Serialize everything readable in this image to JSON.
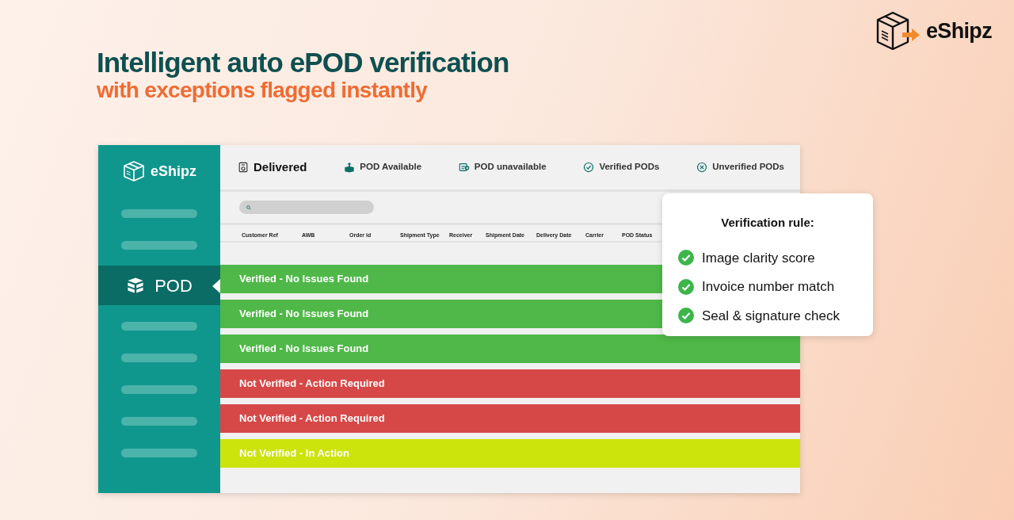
{
  "brand": {
    "name": "eShipz"
  },
  "headline": {
    "title": "Intelligent auto ePOD verification",
    "subtitle": "with exceptions flagged instantly"
  },
  "app": {
    "sidebar": {
      "logo": "eShipz",
      "items": [
        {
          "kind": "placeholder",
          "selected": false
        },
        {
          "kind": "placeholder",
          "selected": false
        },
        {
          "kind": "item",
          "label": "POD",
          "selected": true
        },
        {
          "kind": "placeholder",
          "selected": false
        },
        {
          "kind": "placeholder",
          "selected": false
        },
        {
          "kind": "placeholder",
          "selected": false
        },
        {
          "kind": "placeholder",
          "selected": false
        },
        {
          "kind": "placeholder",
          "selected": false
        }
      ]
    },
    "tabs": [
      {
        "label": "Delivered",
        "selected": true
      },
      {
        "label": "POD Available",
        "selected": false
      },
      {
        "label": "POD unavailable",
        "selected": false
      },
      {
        "label": "Verified PODs",
        "selected": false
      },
      {
        "label": "Unverified PODs",
        "selected": false
      }
    ],
    "table": {
      "columns": [
        "Customer Ref",
        "AWB",
        "Order id",
        "Shipment Type",
        "Receiver",
        "Shipment Date",
        "Delivery Date",
        "Carrier",
        "POD Status"
      ],
      "rows": [
        {
          "status": "Verified - No Issues Found",
          "color": "#4fb848"
        },
        {
          "status": "Verified - No Issues Found",
          "color": "#4fb848"
        },
        {
          "status": "Verified - No Issues Found",
          "color": "#4fb848"
        },
        {
          "status": "Not Verified - Action Required",
          "color": "#d64848"
        },
        {
          "status": "Not Verified - Action Required",
          "color": "#d64848"
        },
        {
          "status": "Not Verified - In Action",
          "color": "#cde30c"
        }
      ]
    }
  },
  "rule_card": {
    "title": "Verification rule:",
    "items": [
      {
        "label": "Image clarity score",
        "checked": true
      },
      {
        "label": "Invoice number match",
        "checked": true
      },
      {
        "label": "Seal & signature check",
        "checked": true
      }
    ]
  }
}
